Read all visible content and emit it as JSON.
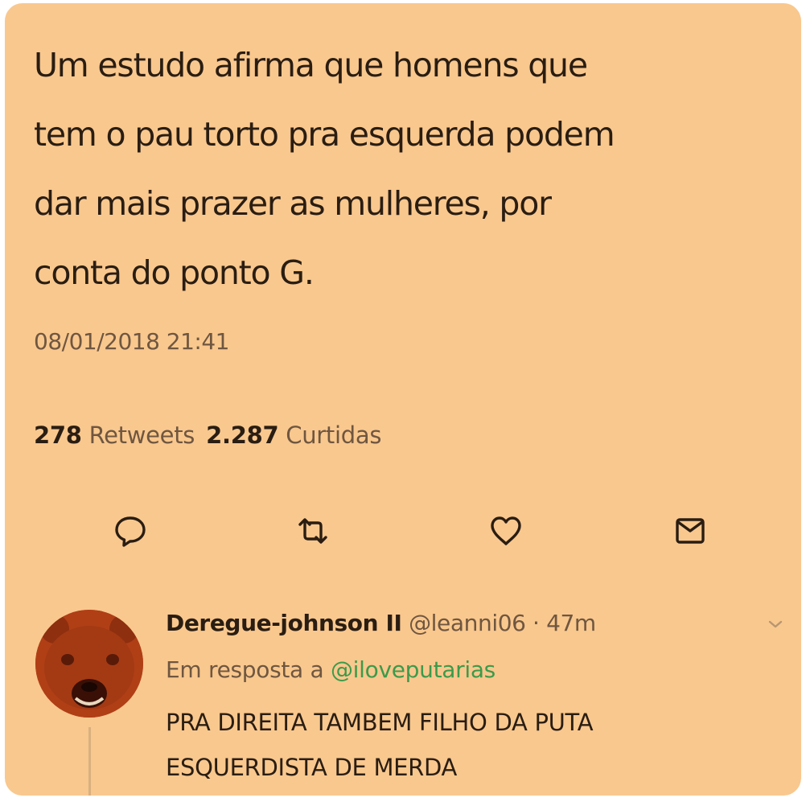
{
  "tweet": {
    "text_lines": [
      "Um estudo afirma que homens que",
      "tem o pau torto pra esquerda podem",
      "dar mais prazer as mulheres, por",
      "conta do ponto G."
    ],
    "timestamp": "08/01/2018 21:41",
    "retweets_count": "278",
    "retweets_label": "Retweets",
    "likes_count": "2.287",
    "likes_label": "Curtidas"
  },
  "actions": [
    {
      "icon": "reply-icon"
    },
    {
      "icon": "retweet-icon"
    },
    {
      "icon": "heart-icon"
    },
    {
      "icon": "message-icon"
    }
  ],
  "reply": {
    "display_name": "Deregue-johnson II",
    "handle": "@leanni06",
    "separator": "·",
    "time": "47m",
    "in_reply_to_label": "Em resposta a",
    "in_reply_to_handle": "@iloveputarias",
    "text_lines": [
      "PRA DIREITA TAMBEM FILHO DA PUTA",
      "ESQUERDISTA DE MERDA"
    ]
  },
  "colors": {
    "background": "#f9c88e",
    "text": "#2a1d12",
    "muted": "#6f5640",
    "mention": "#3c9a4a"
  }
}
